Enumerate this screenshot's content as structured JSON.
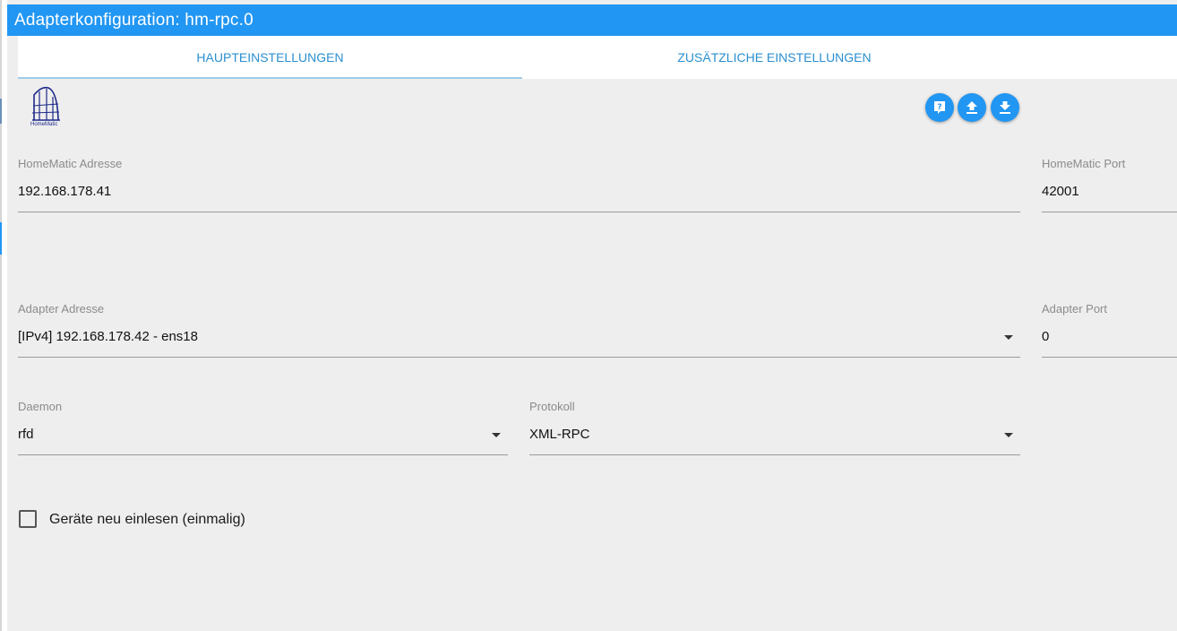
{
  "window": {
    "title": "Adapterkonfiguration: hm-rpc.0"
  },
  "tabs": [
    {
      "label": "HAUPTEINSTELLUNGEN",
      "active": true
    },
    {
      "label": "ZUSÄTZLICHE EINSTELLUNGEN",
      "active": false
    }
  ],
  "logo": {
    "text": "HomeMatic",
    "icon": "homematic-logo"
  },
  "toolbar": {
    "buttons": [
      "help-icon",
      "upload-icon",
      "download-icon"
    ]
  },
  "fields": {
    "homematic_address": {
      "label": "HomeMatic Adresse",
      "value": "192.168.178.41"
    },
    "homematic_port": {
      "label": "HomeMatic Port",
      "value": "42001"
    },
    "adapter_address": {
      "label": "Adapter Adresse",
      "value": "[IPv4] 192.168.178.42 - ens18"
    },
    "adapter_port": {
      "label": "Adapter Port",
      "value": "0"
    },
    "daemon": {
      "label": "Daemon",
      "value": "rfd"
    },
    "protocol": {
      "label": "Protokoll",
      "value": "XML-RPC"
    }
  },
  "checkbox": {
    "label": "Geräte neu einlesen (einmalig)",
    "checked": false
  },
  "colors": {
    "accent": "#2196f3",
    "tab_text": "#2a8fd0",
    "background": "#eeeeee"
  }
}
